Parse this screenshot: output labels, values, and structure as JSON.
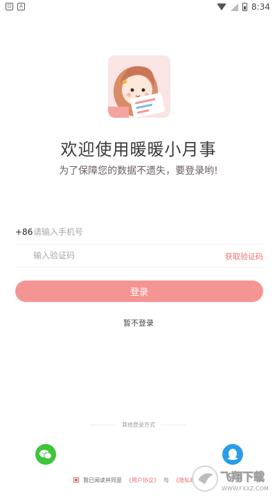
{
  "status_bar": {
    "time": "8:34",
    "left_icon_a": "⊡",
    "left_icon_b": "A"
  },
  "welcome": {
    "title": "欢迎使用暖暖小月事",
    "subtitle": "为了保障您的数据不遗失，要登录哟!"
  },
  "form": {
    "country_code": "+86",
    "phone_placeholder": "请输入手机号",
    "code_placeholder": "输入验证码",
    "get_code_label": "获取验证码",
    "login_label": "登录",
    "skip_label": "暂不登录"
  },
  "other_login": {
    "label": "其他登录方式"
  },
  "agreement": {
    "prefix": "我已阅读并同意",
    "user_agreement": "《用户协议》",
    "conjunction": "与",
    "privacy_policy": "《隐私政"
  },
  "watermark": {
    "text": "飞翔下载",
    "url": "WWW.FXXZ.COM"
  },
  "colors": {
    "accent": "#f59593",
    "link": "#f0706f",
    "wechat": "#3ec53b",
    "qq": "#2b9de8"
  }
}
